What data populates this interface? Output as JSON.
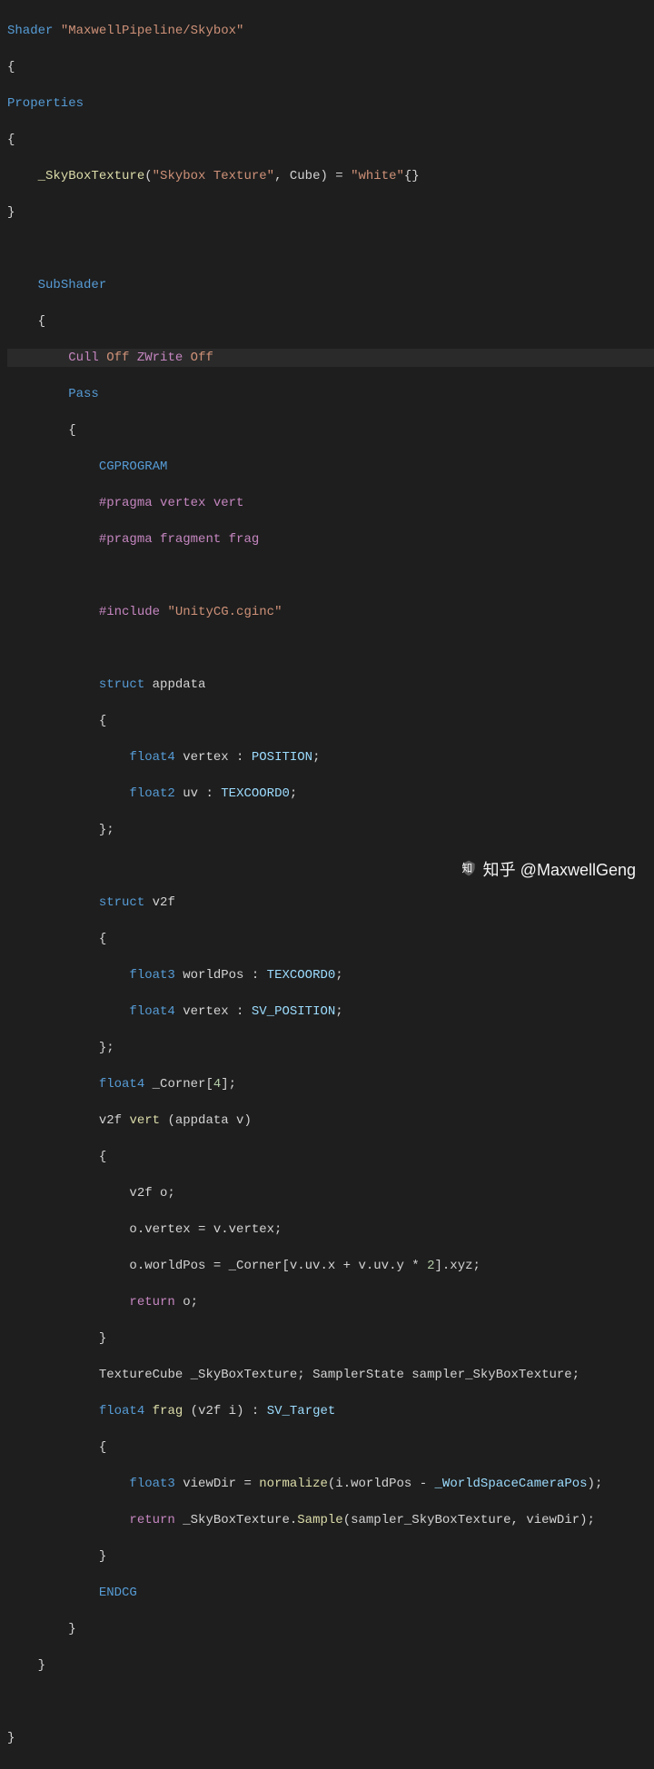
{
  "code": {
    "l1_shader": "Shader",
    "l1_name": "\"MaxwellPipeline/Skybox\"",
    "l2": "{",
    "l3_props": "Properties",
    "l4": "{",
    "l5_fn": "_SkyBoxTexture",
    "l5_args": "(\"Skybox Texture\", Cube) = \"white\"{}",
    "l5_args_paren_open": "(",
    "l5_str1": "\"Skybox Texture\"",
    "l5_comma": ", ",
    "l5_cube": "Cube",
    "l5_close": ") = ",
    "l5_str2": "\"white\"",
    "l5_braces": "{}",
    "l6": "}",
    "l8_sub": "SubShader",
    "l9": "{",
    "l10_cull": "Cull",
    "l10_off1": " Off ",
    "l10_zwrite": "ZWrite",
    "l10_off2": " Off",
    "l11_pass": "Pass",
    "l12": "{",
    "l13_cg": "CGPROGRAM",
    "l14": "#pragma vertex vert",
    "l15": "#pragma fragment frag",
    "l17_inc": "#include",
    "l17_path": " \"UnityCG.cginc\"",
    "l19_struct": "struct",
    "l19_name": " appdata",
    "l20": "{",
    "l21_t": "float4",
    "l21_r": " vertex : ",
    "l21_sem": "POSITION",
    "l21_semi": ";",
    "l22_t": "float2",
    "l22_r": " uv : ",
    "l22_sem": "TEXCOORD0",
    "l23": "};",
    "l25_struct": "struct",
    "l25_name": " v2f",
    "l26": "{",
    "l27_t": "float3",
    "l27_r": " worldPos : ",
    "l27_sem": "TEXCOORD0",
    "l28_t": "float4",
    "l28_r": " vertex : ",
    "l28_sem": "SV_POSITION",
    "l29": "};",
    "l30_t": "float4",
    "l30_r": " _Corner[",
    "l30_n": "4",
    "l30_e": "];",
    "l31_t": "v2f ",
    "l31_fn": "vert",
    "l31_args": " (appdata v)",
    "l32": "{",
    "l33": "v2f o;",
    "l34": "o.vertex = v.vertex;",
    "l35_a": "o.worldPos = _Corner[v.uv.x + v.uv.y * ",
    "l35_n": "2",
    "l35_b": "].xyz;",
    "l36_ret": "return",
    "l36_r": " o;",
    "l37": "}",
    "l38": "TextureCube _SkyBoxTexture; SamplerState sampler_SkyBoxTexture;",
    "l39_t": "float4",
    "l39_sp": " ",
    "l39_fn": "frag",
    "l39_args": " (v2f i) : ",
    "l39_sem": "SV_Target",
    "l40": "{",
    "l41_t": "float3",
    "l41_a": " viewDir = ",
    "l41_fn": "normalize",
    "l41_b": "(i.worldPos - ",
    "l41_g": "_WorldSpaceCameraPos",
    "l41_c": ");",
    "l42_ret": "return",
    "l42_a": " _SkyBoxTexture.",
    "l42_fn": "Sample",
    "l42_b": "(sampler_SkyBoxTexture, viewDir);",
    "l43": "}",
    "l44_end": "ENDCG",
    "l45": "}",
    "l46": "}",
    "l48": "}"
  },
  "watermark": "知乎 @MaxwellGeng"
}
